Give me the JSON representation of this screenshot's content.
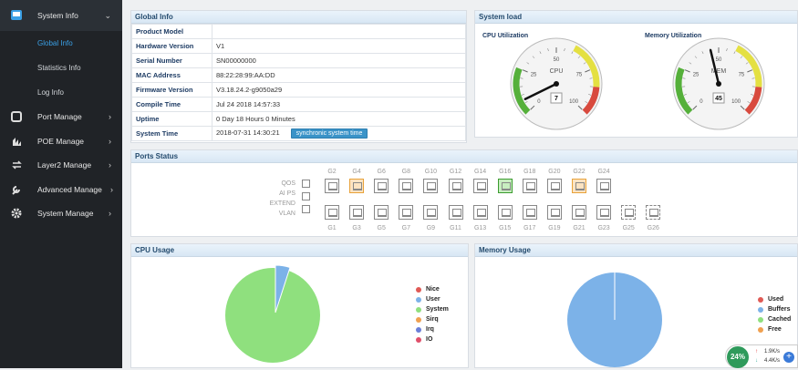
{
  "sidebar": {
    "system_info": "System Info",
    "global_info": "Global Info",
    "statistics_info": "Statistics Info",
    "log_info": "Log Info",
    "port_manage": "Port Manage",
    "poe_manage": "POE Manage",
    "layer2_manage": "Layer2 Manage",
    "advanced_manage": "Advanced Manage",
    "system_manage": "System Manage"
  },
  "global_info": {
    "title": "Global Info",
    "rows": [
      {
        "k": "Product Model",
        "v": ""
      },
      {
        "k": "Hardware Version",
        "v": "V1"
      },
      {
        "k": "Serial Number",
        "v": "SN00000000"
      },
      {
        "k": "MAC Address",
        "v": "88:22:28:99:AA:DD"
      },
      {
        "k": "Firmware Version",
        "v": "V3.18.24.2-g9050a29"
      },
      {
        "k": "Compile Time",
        "v": "Jul 24 2018 14:57:33"
      },
      {
        "k": "Uptime",
        "v": "0 Day 18 Hours 0 Minutes"
      },
      {
        "k": "System Time",
        "v": "2018-07-31 14:30:21"
      }
    ],
    "sync_button": "synchronic system time"
  },
  "system_load": {
    "title": "System load",
    "cpu_label": "CPU Utilization",
    "mem_label": "Memory Utilization",
    "cpu_gauge_name": "CPU",
    "mem_gauge_name": "MEM",
    "cpu_value": "7",
    "mem_value": "45",
    "ticks": [
      "0",
      "25",
      "50",
      "75",
      "100"
    ]
  },
  "ports": {
    "title": "Ports Status",
    "top_labels": [
      "G2",
      "G4",
      "G6",
      "G8",
      "G10",
      "G12",
      "G14",
      "G16",
      "G18",
      "G20",
      "G22",
      "G24"
    ],
    "bottom_labels": [
      "G1",
      "G3",
      "G5",
      "G7",
      "G9",
      "G11",
      "G13",
      "G15",
      "G17",
      "G19",
      "G21",
      "G23",
      "G25",
      "G26"
    ],
    "side_labels": [
      "QOS",
      "AI PS",
      "EXTEND",
      "VLAN"
    ]
  },
  "cpu_usage": {
    "title": "CPU Usage",
    "legend": [
      {
        "name": "Nice",
        "color": "#e05a55"
      },
      {
        "name": "User",
        "color": "#7cb2e8"
      },
      {
        "name": "System",
        "color": "#8fe07e"
      },
      {
        "name": "Sirq",
        "color": "#f0a050"
      },
      {
        "name": "Irq",
        "color": "#6b7fd8"
      },
      {
        "name": "IO",
        "color": "#e04f6a"
      }
    ]
  },
  "memory_usage": {
    "title": "Memory Usage",
    "legend": [
      {
        "name": "Used",
        "color": "#e05a55"
      },
      {
        "name": "Buffers",
        "color": "#7cb2e8"
      },
      {
        "name": "Cached",
        "color": "#8fe07e"
      },
      {
        "name": "Free",
        "color": "#f0a050"
      }
    ]
  },
  "widget": {
    "percent": "24%",
    "up": "1.9K/s",
    "down": "4.4K/s"
  }
}
